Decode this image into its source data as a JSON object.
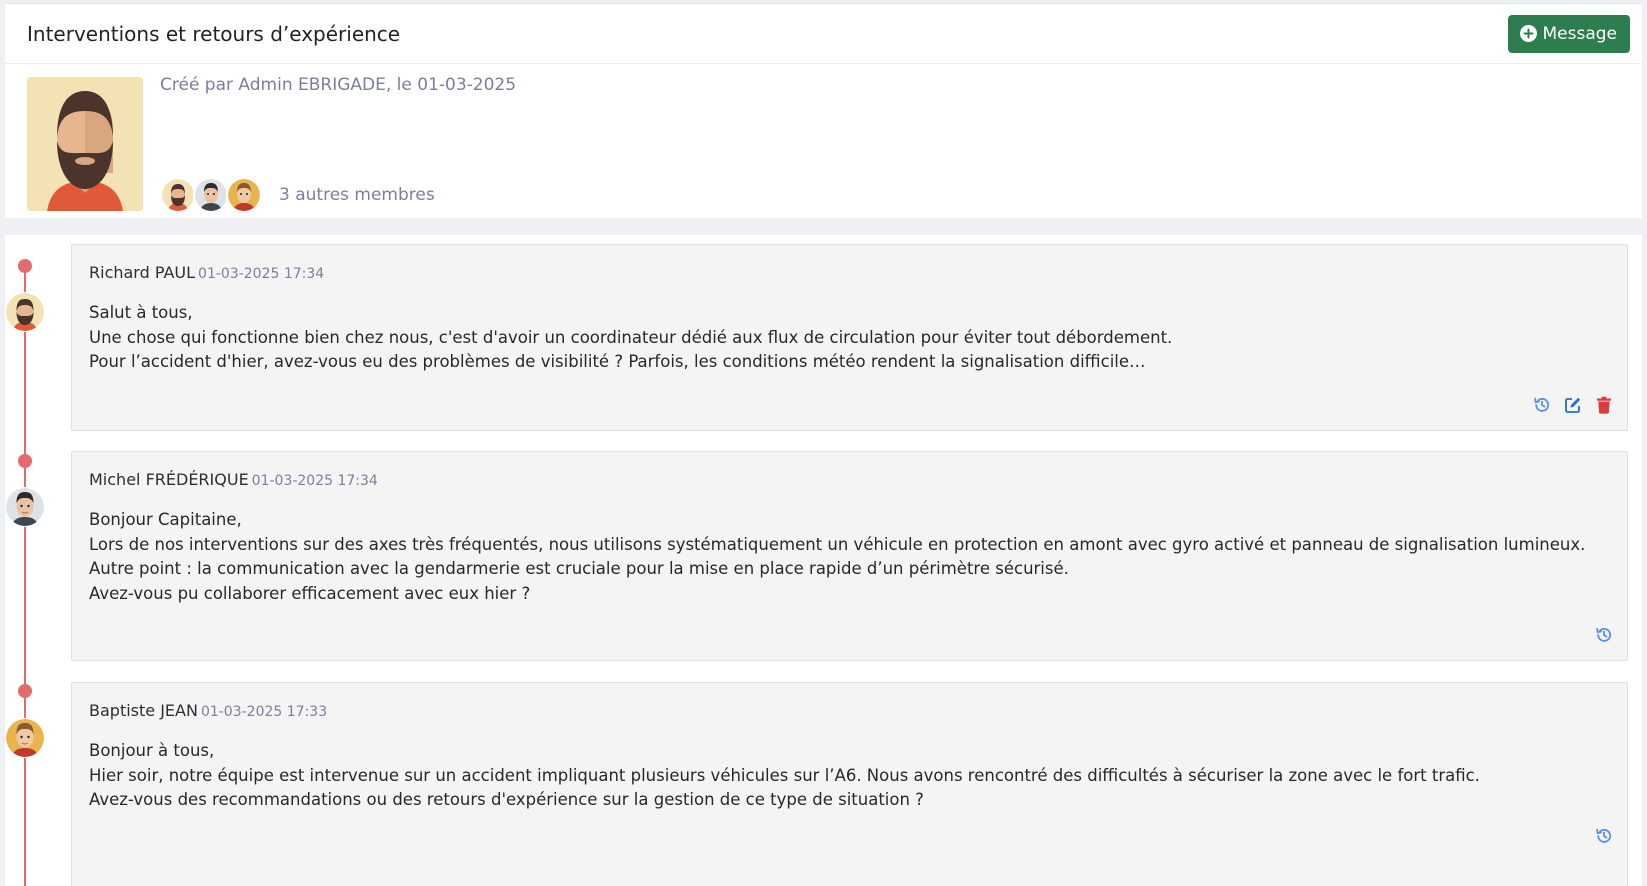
{
  "header": {
    "title": "Interventions et retours d’expérience",
    "message_button": "Message"
  },
  "info": {
    "created_by": "Créé par Admin EBRIGADE, le 01-03-2025",
    "members_label": "3 autres membres"
  },
  "messages": [
    {
      "author": "Richard PAUL",
      "date": "01-03-2025 17:34",
      "lines": [
        "Salut à tous,",
        "Une chose qui fonctionne bien chez nous, c'est d'avoir un coordinateur dédié aux flux de circulation pour éviter tout débordement.",
        "Pour l’accident d'hier, avez-vous eu des problèmes de visibilité ? Parfois, les conditions météo rendent la signalisation difficile…"
      ],
      "actions": [
        "history-icon",
        "edit-icon",
        "trash-icon"
      ]
    },
    {
      "author": "Michel FRÉDÉRIQUE",
      "date": "01-03-2025 17:34",
      "lines": [
        "Bonjour Capitaine,",
        "Lors de nos interventions sur des axes très fréquentés, nous utilisons systématiquement un véhicule en protection en amont avec gyro activé et panneau de signalisation lumineux.",
        "Autre point : la communication avec la gendarmerie est cruciale pour la mise en place rapide d’un périmètre sécurisé.",
        "Avez-vous pu collaborer efficacement avec eux hier ?"
      ],
      "actions": [
        "history-icon"
      ]
    },
    {
      "author": "Baptiste JEAN",
      "date": "01-03-2025 17:33",
      "lines": [
        "Bonjour à tous,",
        "Hier soir, notre équipe est intervenue sur un accident impliquant plusieurs véhicules sur l’A6. Nous avons rencontré des difficultés à sécuriser la zone avec le fort trafic.",
        "Avez-vous des recommandations ou des retours d'expérience sur la gestion de ce type de situation ?"
      ],
      "actions": [
        "history-icon"
      ]
    }
  ],
  "colors": {
    "accent_green": "#2e7d4f",
    "timeline_red": "#e36b6b",
    "action_blue": "#1b6fd8",
    "action_red": "#e03b3b",
    "muted_text": "#7b7f9b"
  }
}
